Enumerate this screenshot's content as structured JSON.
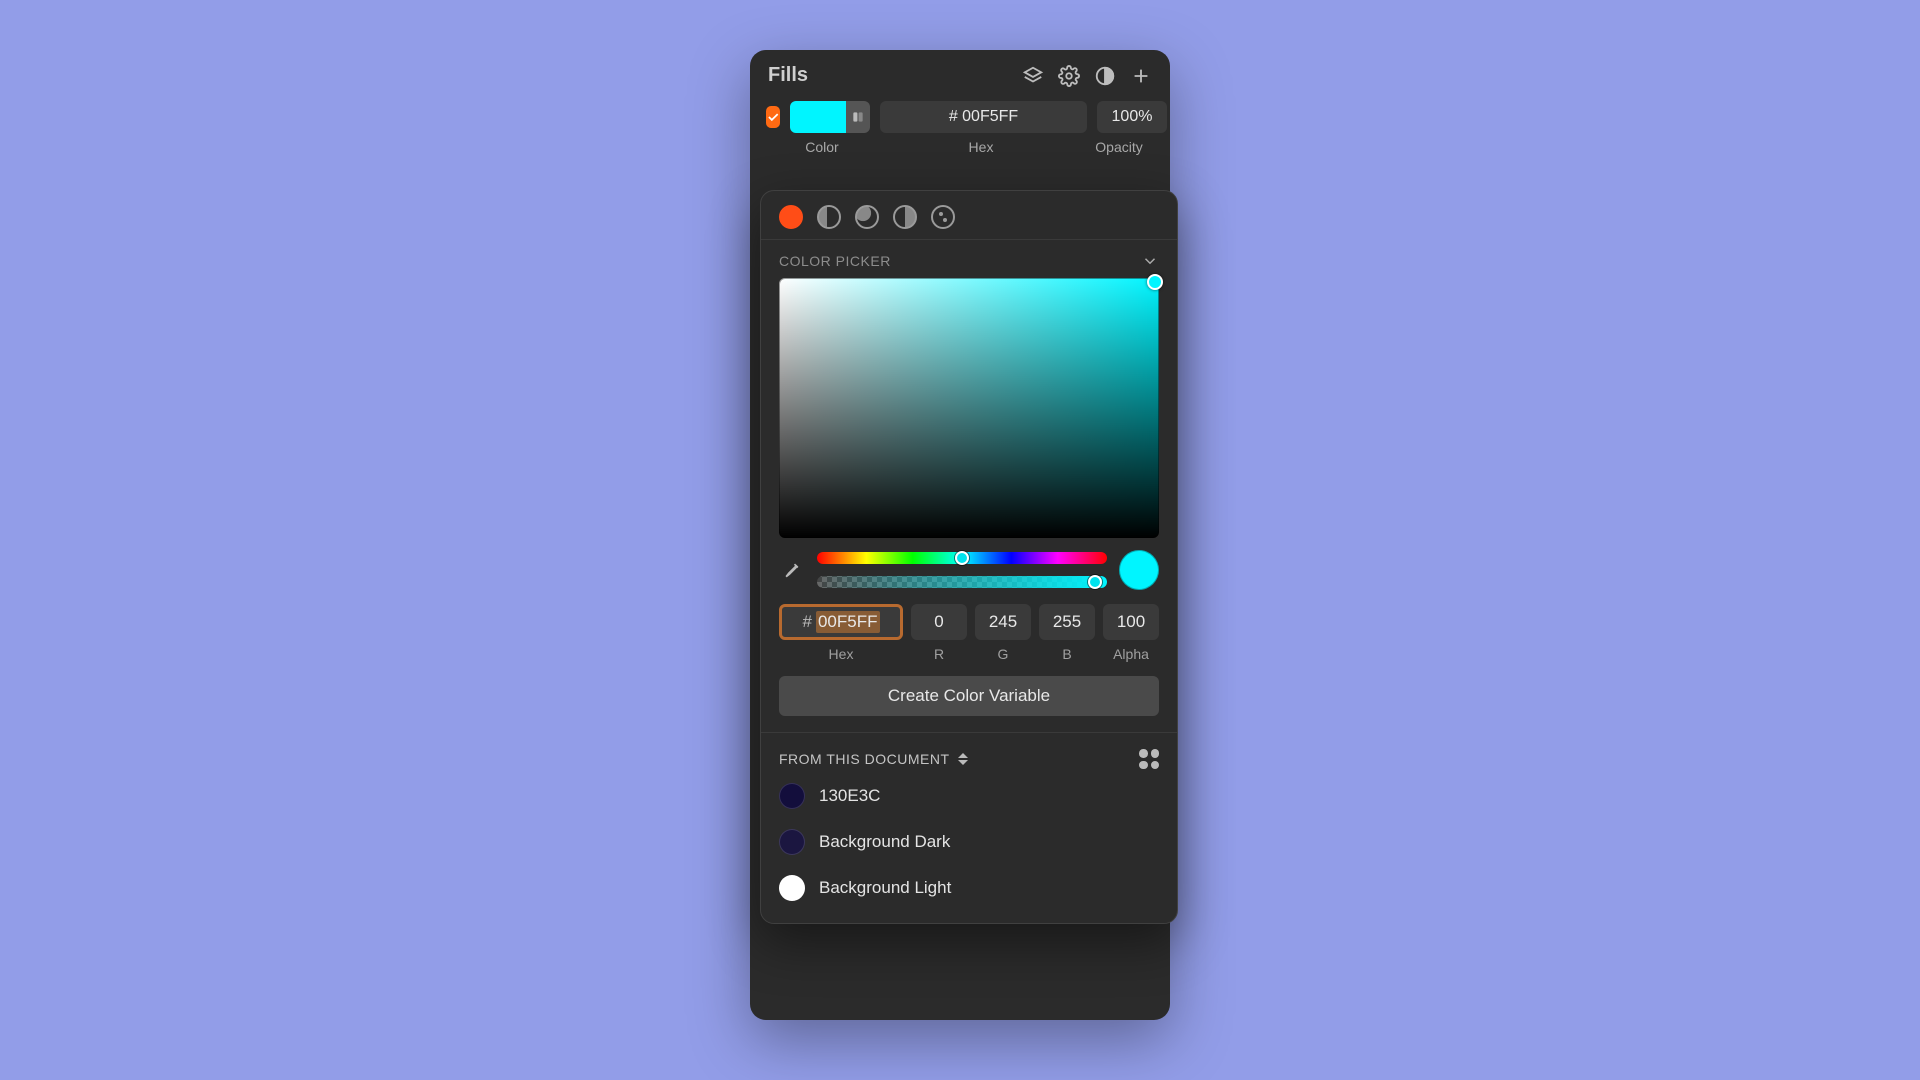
{
  "fills": {
    "title": "Fills",
    "row": {
      "checked": true,
      "color": "#00F5FF",
      "hex_value": "# 00F5FF",
      "opacity": "100%"
    },
    "labels": {
      "color": "Color",
      "hex": "Hex",
      "opacity": "Opacity"
    }
  },
  "picker": {
    "title": "COLOR PICKER",
    "hue_pos_pct": 50,
    "alpha_pos_pct": 96,
    "preview_color": "#00F5FF",
    "fields": {
      "hex": "00F5FF",
      "r": "0",
      "g": "245",
      "b": "255",
      "alpha": "100"
    },
    "field_labels": {
      "hex": "Hex",
      "r": "R",
      "g": "G",
      "b": "B",
      "alpha": "Alpha"
    },
    "create_button": "Create Color Variable"
  },
  "document_colors": {
    "title": "FROM THIS DOCUMENT",
    "items": [
      {
        "color": "#130E3C",
        "label": "130E3C"
      },
      {
        "color": "#1b1640",
        "label": "Background Dark"
      },
      {
        "color": "#FFFFFF",
        "label": "Background Light"
      }
    ]
  }
}
